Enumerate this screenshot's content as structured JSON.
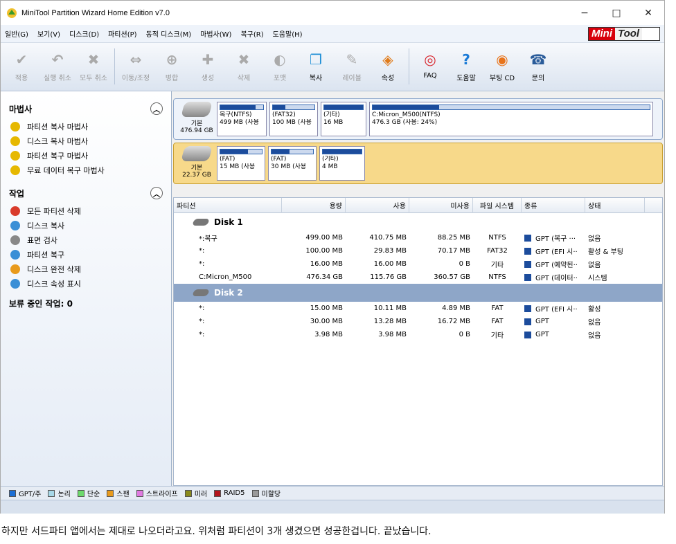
{
  "window": {
    "title": "MiniTool Partition Wizard Home Edition v7.0",
    "minimize": "−",
    "maximize": "□",
    "close": "✕"
  },
  "menu": [
    "일반(G)",
    "보기(V)",
    "디스크(D)",
    "파티션(P)",
    "동적 디스크(M)",
    "마법사(W)",
    "복구(R)",
    "도움말(H)"
  ],
  "logo": {
    "part1": "Mini",
    "part2": "Tool"
  },
  "toolbar": {
    "group1": [
      {
        "label": "적용",
        "icon": "check-icon",
        "glyph": "✔",
        "disabled": true
      },
      {
        "label": "실행 취소",
        "icon": "undo-icon",
        "glyph": "↶",
        "disabled": true
      },
      {
        "label": "모두 취소",
        "icon": "cancel-icon",
        "glyph": "✖",
        "disabled": true
      }
    ],
    "group2": [
      {
        "label": "이동/조정",
        "icon": "move-resize-icon",
        "glyph": "⇔",
        "disabled": true
      },
      {
        "label": "병합",
        "icon": "merge-icon",
        "glyph": "⊕",
        "disabled": true
      },
      {
        "label": "생성",
        "icon": "create-icon",
        "glyph": "✚",
        "disabled": true
      },
      {
        "label": "삭제",
        "icon": "delete-icon",
        "glyph": "✖",
        "disabled": true
      },
      {
        "label": "포맷",
        "icon": "format-icon",
        "glyph": "◐",
        "disabled": true
      },
      {
        "label": "복사",
        "icon": "copy-icon",
        "glyph": "❐",
        "disabled": false
      },
      {
        "label": "레이블",
        "icon": "label-icon",
        "glyph": "✎",
        "disabled": true
      },
      {
        "label": "속성",
        "icon": "properties-icon",
        "glyph": "◈",
        "disabled": false
      }
    ],
    "group3": [
      {
        "label": "FAQ",
        "icon": "faq-lifebuoy-icon",
        "glyph": "◎",
        "disabled": false
      },
      {
        "label": "도움말",
        "icon": "help-icon",
        "glyph": "?",
        "disabled": false
      },
      {
        "label": "부팅 CD",
        "icon": "boot-cd-icon",
        "glyph": "◉",
        "disabled": false
      },
      {
        "label": "문의",
        "icon": "contact-icon",
        "glyph": "☎",
        "disabled": false
      }
    ]
  },
  "sidebar": {
    "wizard_title": "마법사",
    "wizard_items": [
      "파티션 복사 마법사",
      "디스크 복사 마법사",
      "파티션 복구 마법사",
      "무료 데이터 복구 마법사"
    ],
    "ops_title": "작업",
    "ops_items": [
      "모든 파티션 삭제",
      "디스크 복사",
      "표면 검사",
      "파티션 복구",
      "디스크 완전 삭제",
      "디스크 속성 표시"
    ],
    "pending": "보류 중인 작업: 0"
  },
  "diskmap": [
    {
      "type": "기본",
      "size": "476.94 GB",
      "parts": [
        {
          "name": "복구(NTFS)",
          "size": "499 MB (사용",
          "fill": 0.82
        },
        {
          "name": "(FAT32)",
          "size": "100 MB (사용",
          "fill": 0.3
        },
        {
          "name": "(기타)",
          "size": "16 MB",
          "fill": 1.0
        },
        {
          "name": "C:Micron_M500(NTFS)",
          "size": "476.3 GB (사용: 24%)",
          "fill": 0.24
        }
      ]
    },
    {
      "type": "기본",
      "size": "22.37 GB",
      "parts": [
        {
          "name": "(FAT)",
          "size": "15 MB (사용",
          "fill": 0.67
        },
        {
          "name": "(FAT)",
          "size": "30 MB (사용",
          "fill": 0.44
        },
        {
          "name": "(기타)",
          "size": "4 MB",
          "fill": 1.0
        }
      ]
    }
  ],
  "table": {
    "headers": [
      "파티션",
      "용량",
      "사용",
      "미사용",
      "파일 시스템",
      "종류",
      "상태"
    ],
    "disks": [
      {
        "label": "Disk 1",
        "rows": [
          [
            "*:복구",
            "499.00 MB",
            "410.75 MB",
            "88.25 MB",
            "NTFS",
            "GPT (복구 ···",
            "없음"
          ],
          [
            "*:",
            "100.00 MB",
            "29.83 MB",
            "70.17 MB",
            "FAT32",
            "GPT (EFI 시··",
            "활성 & 부팅"
          ],
          [
            "*:",
            "16.00 MB",
            "16.00 MB",
            "0 B",
            "기타",
            "GPT (예약된··",
            "없음"
          ],
          [
            "C:Micron_M500",
            "476.34 GB",
            "115.76 GB",
            "360.57 GB",
            "NTFS",
            "GPT (데이터··",
            "시스템"
          ]
        ]
      },
      {
        "label": "Disk 2",
        "rows": [
          [
            "*:",
            "15.00 MB",
            "10.11 MB",
            "4.89 MB",
            "FAT",
            "GPT (EFI 시··",
            "활성"
          ],
          [
            "*:",
            "30.00 MB",
            "13.28 MB",
            "16.72 MB",
            "FAT",
            "GPT",
            "없음"
          ],
          [
            "*:",
            "3.98 MB",
            "3.98 MB",
            "0 B",
            "기타",
            "GPT",
            "없음"
          ]
        ]
      }
    ]
  },
  "legend": [
    {
      "label": "GPT/주",
      "color": "#1c6fd6"
    },
    {
      "label": "논리",
      "color": "#a8d8e8"
    },
    {
      "label": "단순",
      "color": "#6cd96c"
    },
    {
      "label": "스팬",
      "color": "#e89a1c"
    },
    {
      "label": "스트라이프",
      "color": "#e07ae0"
    },
    {
      "label": "미러",
      "color": "#8a8a1c"
    },
    {
      "label": "RAID5",
      "color": "#b4141c"
    },
    {
      "label": "미할당",
      "color": "#9a9a9a"
    }
  ],
  "caption": "하지만 서드파티 앱에서는 제대로 나오더라고요. 위처럼 파티션이 3개 생겼으면 성공한겁니다. 끝났습니다."
}
